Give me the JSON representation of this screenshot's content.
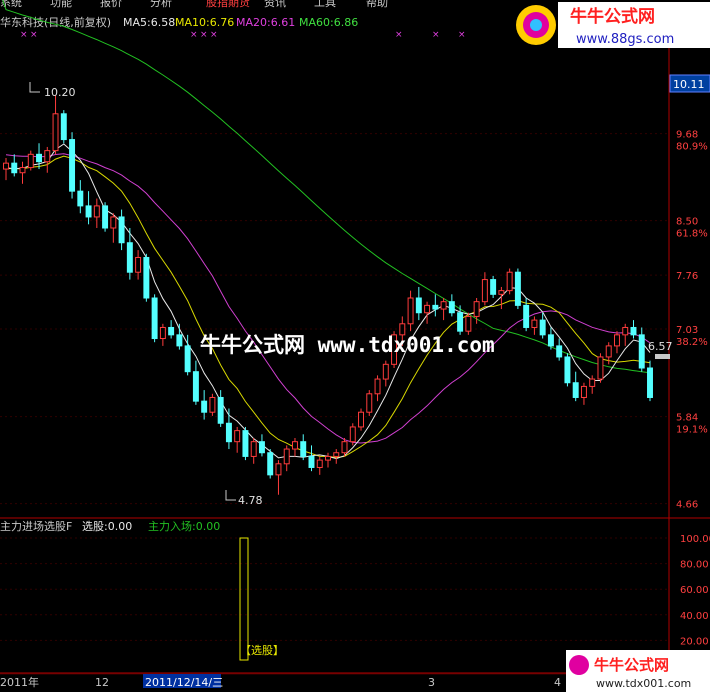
{
  "menu": [
    "系统",
    "功能",
    "报价",
    "分析",
    "股指期货",
    "资讯",
    "工具",
    "帮助"
  ],
  "header": {
    "stock": "华东科技(日线,前复权)",
    "ma5": "MA5:6.58",
    "ma10": "MA10:6.76",
    "ma20": "MA20:6.61",
    "ma60": "MA60:6.86"
  },
  "indicator": {
    "name": "主力进场选股F",
    "value": "选股:0.00",
    "signal": "主力入场:0.00",
    "box_label": "【选股】"
  },
  "watermark": "牛牛公式网 www.tdx001.com",
  "logo_top": {
    "title": "牛牛公式网",
    "url": "www.88gs.com"
  },
  "logo_bottom": {
    "title": "牛牛公式网",
    "url": "www.tdx001.com"
  },
  "current_price_tag": "10.11",
  "price_axis": [
    {
      "label": "9.68",
      "pct": "80.9%"
    },
    {
      "label": "8.50",
      "pct": "61.8%"
    },
    {
      "label": "7.76",
      "pct": ""
    },
    {
      "label": "7.03",
      "pct": "38.2%"
    },
    {
      "label": "5.84",
      "pct": "19.1%"
    },
    {
      "label": "4.66",
      "pct": ""
    }
  ],
  "indicator_axis": [
    "100.00",
    "80.00",
    "60.00",
    "40.00",
    "20.00"
  ],
  "date_axis": {
    "start": "2011年",
    "m12": "12",
    "selected": "2011/12/14/三",
    "m3": "3",
    "m4": "4"
  },
  "chart_data": {
    "type": "candlestick",
    "high_marker": "10.20",
    "low_marker": "4.78",
    "last_marker": "6.57",
    "ylim": [
      4.6,
      10.3
    ],
    "candles": [
      [
        9.2,
        9.35,
        9.05,
        9.28
      ],
      [
        9.28,
        9.4,
        9.1,
        9.15
      ],
      [
        9.15,
        9.3,
        9.0,
        9.22
      ],
      [
        9.22,
        9.45,
        9.18,
        9.4
      ],
      [
        9.4,
        9.55,
        9.2,
        9.3
      ],
      [
        9.3,
        9.5,
        9.15,
        9.45
      ],
      [
        9.45,
        10.2,
        9.4,
        9.95
      ],
      [
        9.95,
        10.0,
        9.55,
        9.6
      ],
      [
        9.6,
        9.7,
        8.8,
        8.9
      ],
      [
        8.9,
        9.05,
        8.6,
        8.7
      ],
      [
        8.7,
        8.9,
        8.45,
        8.55
      ],
      [
        8.55,
        8.8,
        8.4,
        8.7
      ],
      [
        8.7,
        8.75,
        8.35,
        8.4
      ],
      [
        8.4,
        8.6,
        8.2,
        8.55
      ],
      [
        8.55,
        8.65,
        8.1,
        8.2
      ],
      [
        8.2,
        8.4,
        7.7,
        7.8
      ],
      [
        7.8,
        8.1,
        7.7,
        8.0
      ],
      [
        8.0,
        8.05,
        7.4,
        7.45
      ],
      [
        7.45,
        7.5,
        6.85,
        6.9
      ],
      [
        6.9,
        7.1,
        6.8,
        7.05
      ],
      [
        7.05,
        7.15,
        6.9,
        6.95
      ],
      [
        6.95,
        7.1,
        6.75,
        6.8
      ],
      [
        6.8,
        6.95,
        6.4,
        6.45
      ],
      [
        6.45,
        6.6,
        6.0,
        6.05
      ],
      [
        6.05,
        6.2,
        5.8,
        5.9
      ],
      [
        5.9,
        6.15,
        5.85,
        6.1
      ],
      [
        6.1,
        6.2,
        5.7,
        5.75
      ],
      [
        5.75,
        5.95,
        5.4,
        5.5
      ],
      [
        5.5,
        5.7,
        5.35,
        5.65
      ],
      [
        5.65,
        5.7,
        5.25,
        5.3
      ],
      [
        5.3,
        5.55,
        5.2,
        5.5
      ],
      [
        5.5,
        5.6,
        5.3,
        5.35
      ],
      [
        5.35,
        5.4,
        5.0,
        5.05
      ],
      [
        5.05,
        5.25,
        4.78,
        5.2
      ],
      [
        5.2,
        5.45,
        5.1,
        5.4
      ],
      [
        5.4,
        5.55,
        5.3,
        5.5
      ],
      [
        5.5,
        5.6,
        5.25,
        5.3
      ],
      [
        5.3,
        5.45,
        5.1,
        5.15
      ],
      [
        5.15,
        5.3,
        5.05,
        5.25
      ],
      [
        5.25,
        5.35,
        5.15,
        5.3
      ],
      [
        5.3,
        5.4,
        5.2,
        5.35
      ],
      [
        5.35,
        5.55,
        5.3,
        5.5
      ],
      [
        5.5,
        5.75,
        5.45,
        5.7
      ],
      [
        5.7,
        5.95,
        5.65,
        5.9
      ],
      [
        5.9,
        6.2,
        5.85,
        6.15
      ],
      [
        6.15,
        6.4,
        6.05,
        6.35
      ],
      [
        6.35,
        6.6,
        6.25,
        6.55
      ],
      [
        6.55,
        7.0,
        6.5,
        6.95
      ],
      [
        6.95,
        7.2,
        6.8,
        7.1
      ],
      [
        7.1,
        7.55,
        7.0,
        7.45
      ],
      [
        7.45,
        7.6,
        7.15,
        7.25
      ],
      [
        7.25,
        7.4,
        7.1,
        7.35
      ],
      [
        7.35,
        7.5,
        7.2,
        7.3
      ],
      [
        7.3,
        7.45,
        7.15,
        7.4
      ],
      [
        7.4,
        7.5,
        7.2,
        7.25
      ],
      [
        7.25,
        7.35,
        6.95,
        7.0
      ],
      [
        7.0,
        7.25,
        6.95,
        7.2
      ],
      [
        7.2,
        7.45,
        7.1,
        7.4
      ],
      [
        7.4,
        7.8,
        7.35,
        7.7
      ],
      [
        7.7,
        7.75,
        7.45,
        7.5
      ],
      [
        7.5,
        7.6,
        7.3,
        7.55
      ],
      [
        7.55,
        7.85,
        7.5,
        7.8
      ],
      [
        7.8,
        7.85,
        7.3,
        7.35
      ],
      [
        7.35,
        7.45,
        7.0,
        7.05
      ],
      [
        7.05,
        7.2,
        6.95,
        7.15
      ],
      [
        7.15,
        7.25,
        6.9,
        6.95
      ],
      [
        6.95,
        7.05,
        6.75,
        6.8
      ],
      [
        6.8,
        6.9,
        6.6,
        6.65
      ],
      [
        6.65,
        6.7,
        6.25,
        6.3
      ],
      [
        6.3,
        6.45,
        6.05,
        6.1
      ],
      [
        6.1,
        6.3,
        6.0,
        6.25
      ],
      [
        6.25,
        6.4,
        6.15,
        6.35
      ],
      [
        6.35,
        6.7,
        6.3,
        6.65
      ],
      [
        6.65,
        6.85,
        6.55,
        6.8
      ],
      [
        6.8,
        7.0,
        6.7,
        6.95
      ],
      [
        6.95,
        7.1,
        6.8,
        7.05
      ],
      [
        7.05,
        7.15,
        6.9,
        6.95
      ],
      [
        6.95,
        7.05,
        6.45,
        6.5
      ],
      [
        6.5,
        6.6,
        6.05,
        6.1
      ]
    ]
  }
}
